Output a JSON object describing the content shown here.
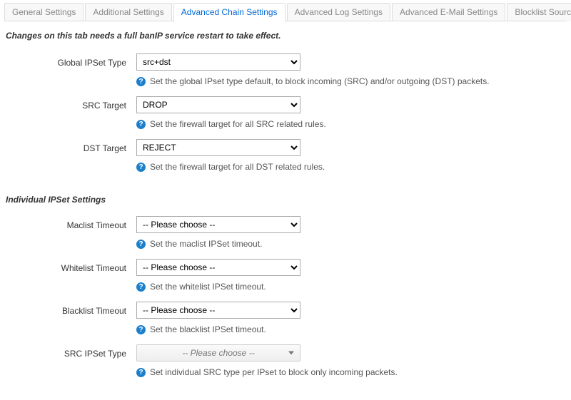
{
  "tabs": [
    "General Settings",
    "Additional Settings",
    "Advanced Chain Settings",
    "Advanced Log Settings",
    "Advanced E-Mail Settings",
    "Blocklist Sources"
  ],
  "active_tab_index": 2,
  "note": "Changes on this tab needs a full banIP service restart to take effect.",
  "section_individual": "Individual IPSet Settings",
  "help_glyph": "?",
  "fields": {
    "global_ipset_type": {
      "label": "Global IPSet Type",
      "value": "src+dst",
      "help": "Set the global IPset type default, to block incoming (SRC) and/or outgoing (DST) packets."
    },
    "src_target": {
      "label": "SRC Target",
      "value": "DROP",
      "help": "Set the firewall target for all SRC related rules."
    },
    "dst_target": {
      "label": "DST Target",
      "value": "REJECT",
      "help": "Set the firewall target for all DST related rules."
    },
    "maclist_timeout": {
      "label": "Maclist Timeout",
      "value": "-- Please choose --",
      "help": "Set the maclist IPSet timeout."
    },
    "whitelist_timeout": {
      "label": "Whitelist Timeout",
      "value": "-- Please choose --",
      "help": "Set the whitelist IPSet timeout."
    },
    "blacklist_timeout": {
      "label": "Blacklist Timeout",
      "value": "-- Please choose --",
      "help": "Set the blacklist IPSet timeout."
    },
    "src_ipset_type": {
      "label": "SRC IPSet Type",
      "value": "-- Please choose --",
      "help": "Set individual SRC type per IPset to block only incoming packets."
    }
  }
}
